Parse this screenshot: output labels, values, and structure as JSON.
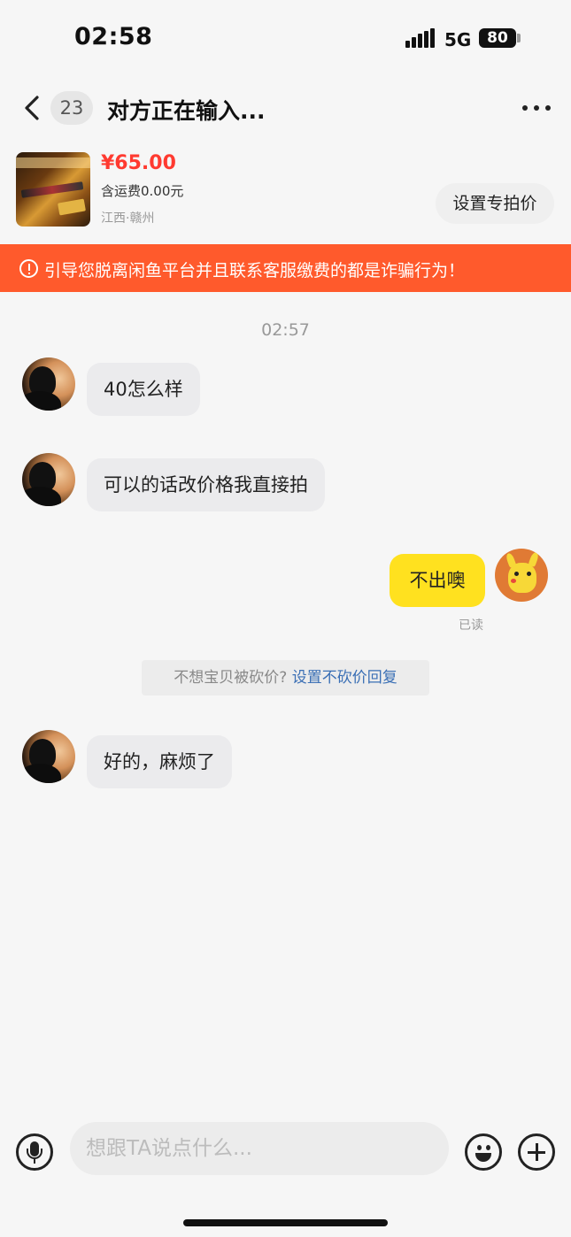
{
  "status_bar": {
    "time": "02:58",
    "network": "5G",
    "battery": "80"
  },
  "nav": {
    "unread_count": "23",
    "title": "对方正在输入..."
  },
  "product": {
    "price": "¥65.00",
    "shipping": "含运费0.00元",
    "location": "江西·赣州",
    "special_price_button": "设置专拍价"
  },
  "warning": {
    "text": "引导您脱离闲鱼平台并且联系客服缴费的都是诈骗行为！"
  },
  "chat": {
    "timestamp": "02:57",
    "messages": [
      {
        "from": "other",
        "text": "40怎么样"
      },
      {
        "from": "other",
        "text": "可以的话改价格我直接拍"
      },
      {
        "from": "me",
        "text": "不出噢",
        "status": "已读"
      },
      {
        "from": "other",
        "text": "好的，麻烦了"
      }
    ],
    "hint": {
      "text": "不想宝贝被砍价? ",
      "link": "设置不砍价回复"
    }
  },
  "input_bar": {
    "placeholder": "想跟TA说点什么..."
  },
  "colors": {
    "price": "#ff3a30",
    "warning_bg": "#ff5a2c",
    "my_bubble": "#ffe11f",
    "link": "#3a6fb5"
  }
}
